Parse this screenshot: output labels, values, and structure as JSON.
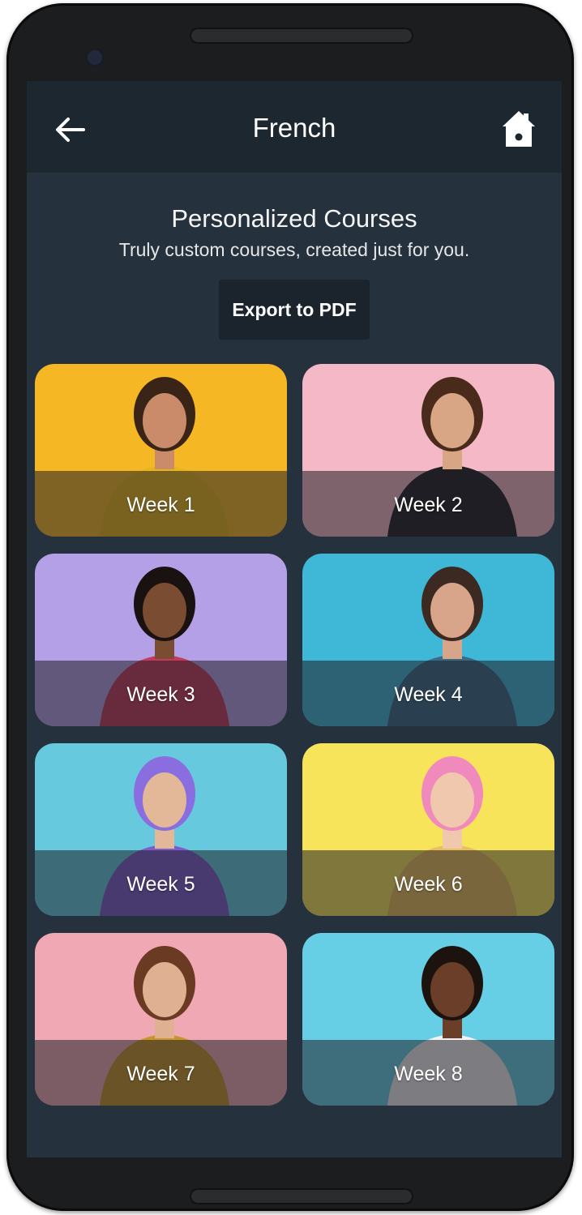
{
  "app": {
    "title": "French"
  },
  "header": {
    "title": "Personalized Courses",
    "subtitle": "Truly custom courses, created just for you.",
    "export_label": "Export to PDF"
  },
  "weeks": [
    {
      "label": "Week 1",
      "bg": "#f5b824",
      "skin": "#c98b6a",
      "hair": "#3a2418",
      "shirt": "#e8b51c"
    },
    {
      "label": "Week 2",
      "bg": "#f4b8c6",
      "skin": "#d8a585",
      "hair": "#4a2a1a",
      "shirt": "#1f1f24"
    },
    {
      "label": "Week 3",
      "bg": "#b4a0e6",
      "skin": "#7a4c32",
      "hair": "#1a1210",
      "shirt": "#c43a5c"
    },
    {
      "label": "Week 4",
      "bg": "#3fb7d6",
      "skin": "#d9a58a",
      "hair": "#3c2a22",
      "shirt": "#3a6a86"
    },
    {
      "label": "Week 5",
      "bg": "#66c9de",
      "skin": "#e3b898",
      "hair": "#8a6ee0",
      "shirt": "#7c5cc8"
    },
    {
      "label": "Week 6",
      "bg": "#f7e45a",
      "skin": "#f0c8ae",
      "hair": "#f08abc",
      "shirt": "#e8bf5c"
    },
    {
      "label": "Week 7",
      "bg": "#f0a8b4",
      "skin": "#e0b092",
      "hair": "#6a3a22",
      "shirt": "#c89628"
    },
    {
      "label": "Week 8",
      "bg": "#66cfe6",
      "skin": "#6a3e28",
      "hair": "#1c130f",
      "shirt": "#f2f2f2"
    }
  ],
  "icons": {
    "back": "arrow-left-icon",
    "home": "home-icon"
  }
}
